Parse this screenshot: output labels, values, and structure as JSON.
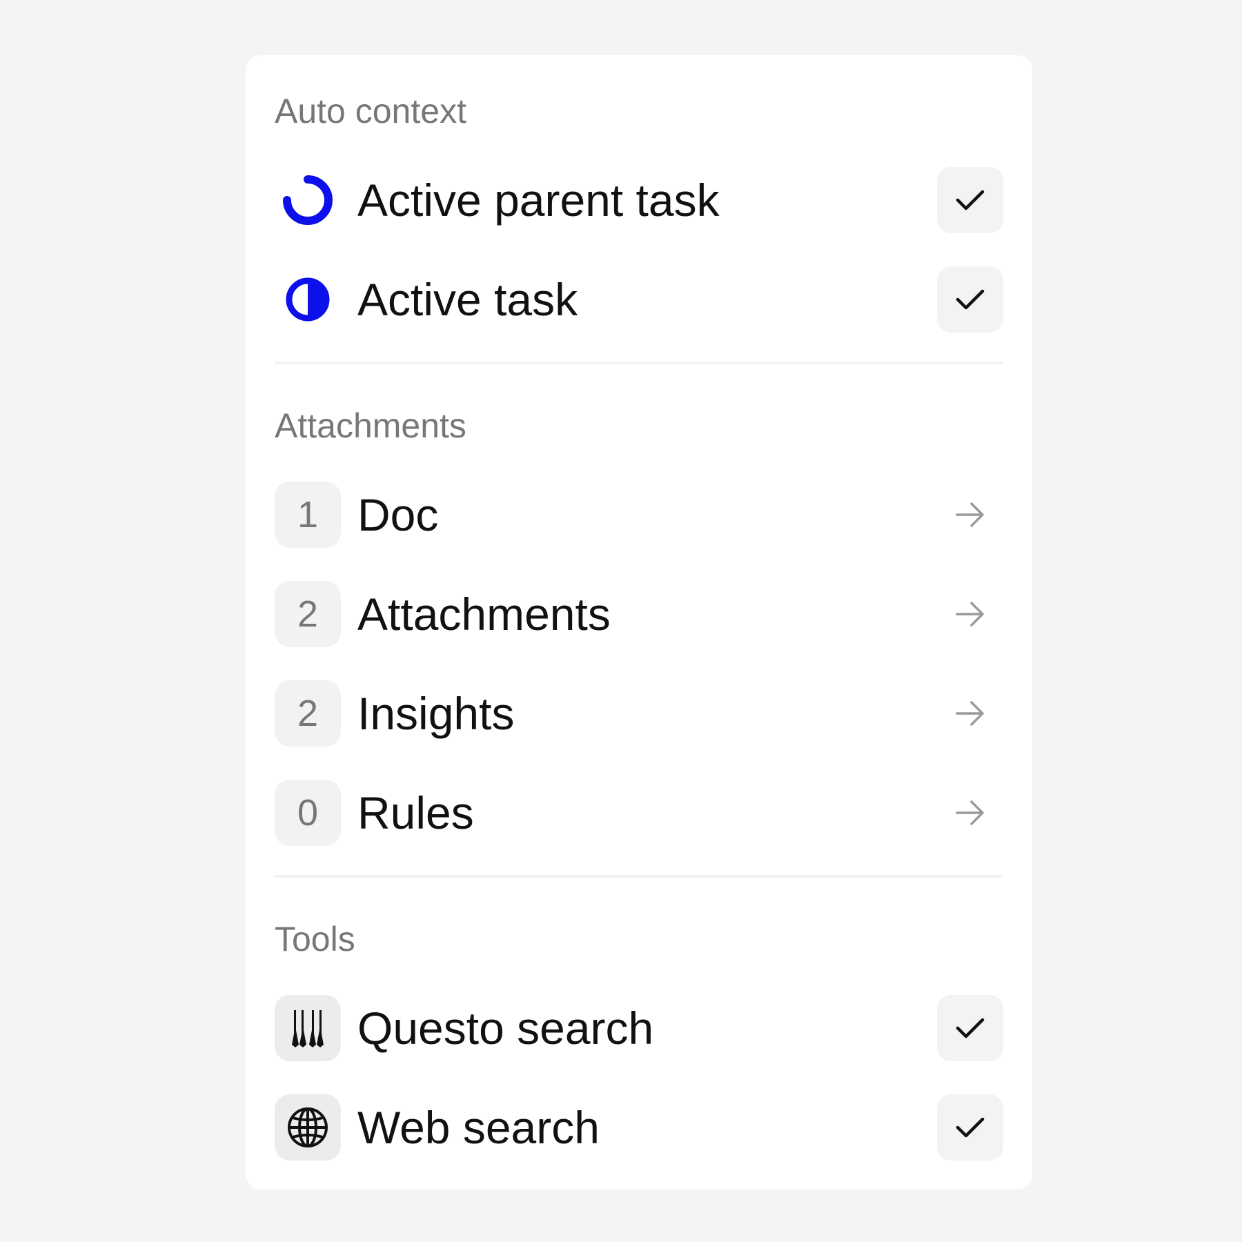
{
  "colors": {
    "accent": "#0d10e8",
    "muted_text": "#777777",
    "primary_text": "#111111",
    "chip_bg": "#f2f2f2"
  },
  "auto_context": {
    "title": "Auto context",
    "items": [
      {
        "label": "Active parent task",
        "icon": "progress-arc-icon",
        "checked": true
      },
      {
        "label": "Active task",
        "icon": "half-circle-icon",
        "checked": true
      }
    ]
  },
  "attachments": {
    "title": "Attachments",
    "items": [
      {
        "count": "1",
        "label": "Doc",
        "icon": "arrow-right-icon"
      },
      {
        "count": "2",
        "label": "Attachments",
        "icon": "arrow-right-icon"
      },
      {
        "count": "2",
        "label": "Insights",
        "icon": "arrow-right-icon"
      },
      {
        "count": "0",
        "label": "Rules",
        "icon": "arrow-right-icon"
      }
    ]
  },
  "tools": {
    "title": "Tools",
    "items": [
      {
        "label": "Questo search",
        "icon": "questo-logo-icon",
        "checked": true
      },
      {
        "label": "Web search",
        "icon": "globe-icon",
        "checked": true
      }
    ]
  }
}
